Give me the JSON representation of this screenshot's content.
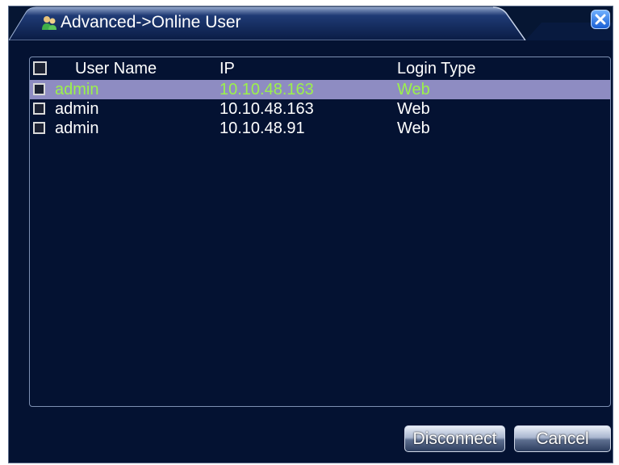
{
  "window": {
    "title": "Advanced->Online User",
    "title_icon": "users-icon",
    "close_icon": "close-icon"
  },
  "table": {
    "headers": {
      "user_name": "User Name",
      "ip": "IP",
      "login_type": "Login Type"
    },
    "rows": [
      {
        "user_name": "admin",
        "ip": "10.10.48.163",
        "login_type": "Web",
        "selected": true
      },
      {
        "user_name": "admin",
        "ip": "10.10.48.163",
        "login_type": "Web",
        "selected": false
      },
      {
        "user_name": "admin",
        "ip": "10.10.48.91",
        "login_type": "Web",
        "selected": false
      }
    ]
  },
  "buttons": {
    "disconnect": "Disconnect",
    "cancel": "Cancel"
  },
  "colors": {
    "background": "#041232",
    "selected_row": "#8e8cc2",
    "selected_text": "#9cf24a"
  }
}
